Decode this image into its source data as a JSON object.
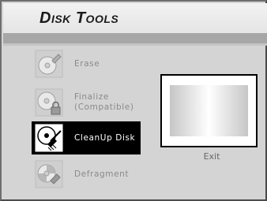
{
  "app": {
    "title": "Disk Tools"
  },
  "menu": {
    "items": [
      {
        "label": "Erase",
        "icon": "disc-erase-icon",
        "selected": false
      },
      {
        "label": "Finalize\n(Compatible)",
        "icon": "disc-lock-icon",
        "selected": false
      },
      {
        "label": "CleanUp Disk",
        "icon": "disc-cleanup-icon",
        "selected": true
      },
      {
        "label": "Defragment",
        "icon": "disc-defragment-icon",
        "selected": false
      }
    ]
  },
  "preview": {
    "exit_label": "Exit"
  },
  "colors": {
    "selected_bg": "#000000",
    "selected_text": "#ffffff",
    "band": "#a7a7a7"
  }
}
